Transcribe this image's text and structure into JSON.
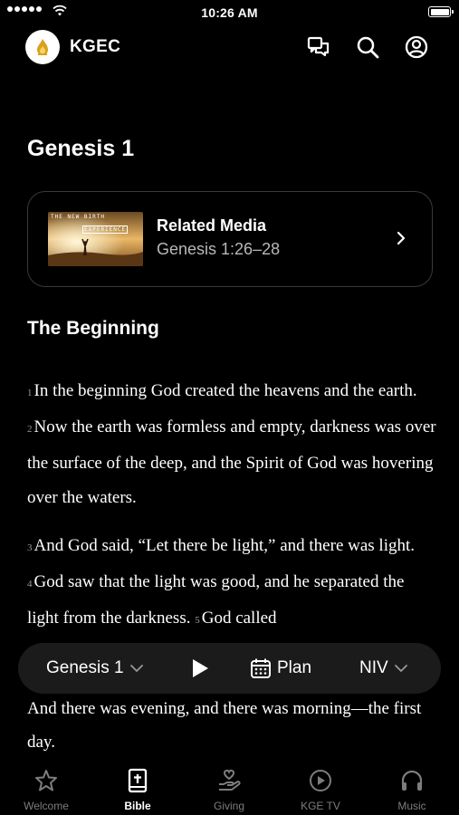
{
  "status_bar": {
    "time": "10:26 AM"
  },
  "header": {
    "brand": "KGEC",
    "icons": [
      "chat-icon",
      "search-icon",
      "account-icon"
    ]
  },
  "page": {
    "title": "Genesis 1"
  },
  "related_media": {
    "title": "Related Media",
    "reference": "Genesis 1:26–28",
    "thumbnail_text_line1": "THE NEW BIRTH",
    "thumbnail_text_line2": "EXPERIENCE"
  },
  "section": {
    "heading": "The Beginning"
  },
  "scripture": {
    "paragraph1": {
      "v1_num": "1",
      "v1_text": "In the beginning God created the heavens and the earth.",
      "v2_num": "2",
      "v2_text": "Now the earth was formless and empty, darkness was over the surface of the deep, and the Spirit of God was hovering over the waters."
    },
    "paragraph2": {
      "v3_num": "3",
      "v3_text": "And God said, “Let there be light,” and there was light.",
      "v4_num": "4",
      "v4_text": "God saw that the light was good, and he separated the light from the darkness.",
      "v5_num": "5",
      "v5_text": "God called"
    },
    "tail": "And there was evening, and there was morning—the first day."
  },
  "player": {
    "chapter": "Genesis 1",
    "plan_label": "Plan",
    "version": "NIV"
  },
  "tabs": [
    {
      "label": "Welcome",
      "icon": "star-icon",
      "active": false
    },
    {
      "label": "Bible",
      "icon": "bible-icon",
      "active": true
    },
    {
      "label": "Giving",
      "icon": "giving-icon",
      "active": false
    },
    {
      "label": "KGE TV",
      "icon": "play-circle-icon",
      "active": false
    },
    {
      "label": "Music",
      "icon": "headphones-icon",
      "active": false
    }
  ],
  "colors": {
    "background": "#000000",
    "text": "#ffffff",
    "muted": "#7d7d7d",
    "card_border": "#3a3a3a",
    "player_bg": "#1b1b1b",
    "logo_accent": "#d9a21b"
  }
}
